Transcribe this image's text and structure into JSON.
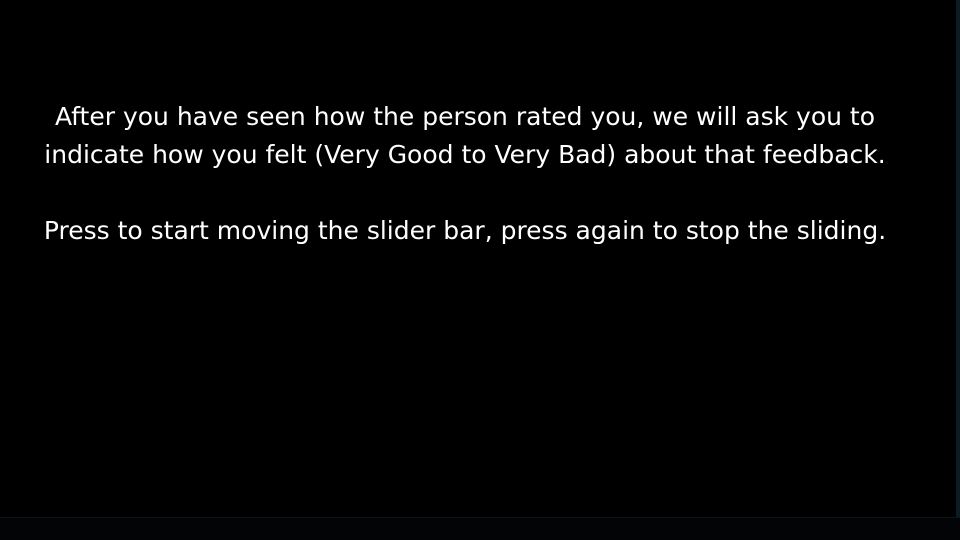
{
  "instructions": {
    "paragraph_1": "After you have seen how the person rated you, we will ask you to indicate how you felt (Very Good to Very Bad) about that feedback.",
    "paragraph_2": "Press to start moving the slider bar, press again to stop the sliding."
  },
  "colors": {
    "background": "#000000",
    "text": "#ffffff"
  }
}
